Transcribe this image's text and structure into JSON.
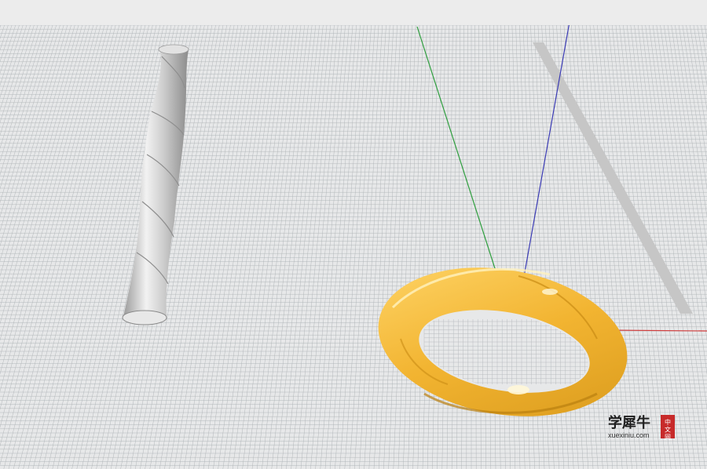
{
  "viewport": {
    "background": "#e7e8e9",
    "grid_color": "#aeb2b6",
    "axes": {
      "x_color": "#d03c3c",
      "y_color": "#2e9e3e",
      "z_color": "#3a3ab4"
    }
  },
  "objects": [
    {
      "name": "Twisted column",
      "color": "#d3d3d3"
    },
    {
      "name": "Twisted torus ring",
      "color": "#f5bd3f"
    },
    {
      "name": "Flat gray bar",
      "color": "#c6c6c6"
    }
  ],
  "watermark": {
    "logo_text": "学犀牛",
    "badge_text": "中文网",
    "url": "xuexiniu.com"
  }
}
